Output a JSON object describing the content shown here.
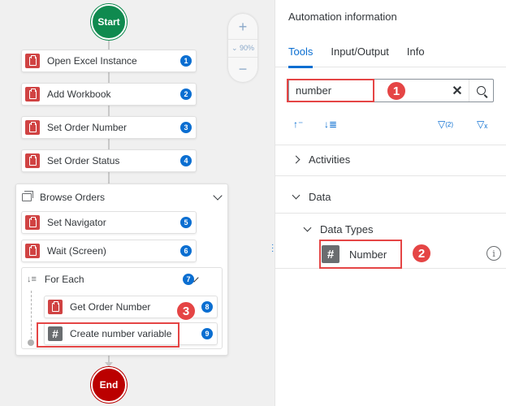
{
  "canvas": {
    "start_label": "Start",
    "end_label": "End",
    "zoom": {
      "plus": "+",
      "level": "90%",
      "minus": "−"
    },
    "steps": [
      {
        "label": "Open Excel Instance",
        "badge": "1"
      },
      {
        "label": "Add Workbook",
        "badge": "2"
      },
      {
        "label": "Set Order Number",
        "badge": "3"
      },
      {
        "label": "Set Order Status",
        "badge": "4"
      }
    ],
    "browse_group": {
      "label": "Browse Orders",
      "steps": [
        {
          "label": "Set Navigator",
          "badge": "5"
        },
        {
          "label": "Wait (Screen)",
          "badge": "6"
        }
      ],
      "for_each": {
        "label": "For Each",
        "badge": "7",
        "steps": [
          {
            "label": "Get Order Number",
            "badge": "8"
          },
          {
            "label": "Create number variable",
            "badge": "9"
          }
        ]
      }
    },
    "callout_3": "3"
  },
  "panel": {
    "title": "Automation information",
    "tabs": [
      {
        "label": "Tools",
        "active": true
      },
      {
        "label": "Input/Output",
        "active": false
      },
      {
        "label": "Info",
        "active": false
      }
    ],
    "search": {
      "value": "number",
      "clear": "✕"
    },
    "callout_1": "1",
    "filter_count": "(2)",
    "tree": {
      "activities": "Activities",
      "data": "Data",
      "data_types": "Data Types",
      "number": "Number"
    },
    "callout_2": "2",
    "info_glyph": "i"
  },
  "colors": {
    "accent": "#0a6ed1",
    "activity_red": "#d04343",
    "start_green": "#0f8a4f",
    "end_red": "#bb0000",
    "highlight": "#e54545"
  },
  "icons": [
    "clipboard-icon",
    "hash-icon",
    "group-icon",
    "loop-icon",
    "search-icon",
    "sort-asc-icon",
    "sort-desc-icon",
    "filter-icon",
    "clear-filter-icon",
    "info-icon",
    "chevron-down-icon",
    "chevron-right-icon"
  ]
}
